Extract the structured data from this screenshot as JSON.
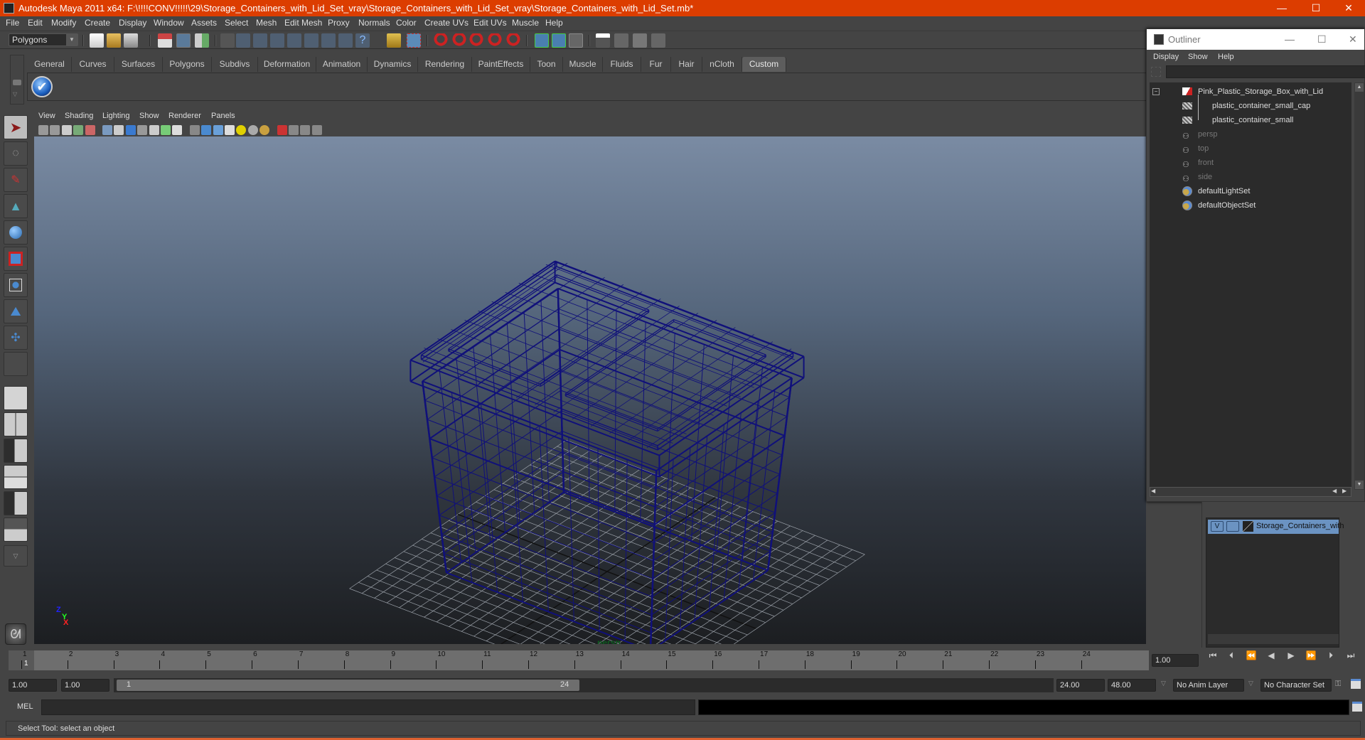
{
  "window": {
    "title": "Autodesk Maya 2011 x64: F:\\!!!!CONV!!!!!\\29\\Storage_Containers_with_Lid_Set_vray\\Storage_Containers_with_Lid_Set_vray\\Storage_Containers_with_Lid_Set.mb*",
    "minimize": "—",
    "maximize": "☐",
    "close": "✕"
  },
  "menubar": {
    "items": [
      "File",
      "Edit",
      "Modify",
      "Create",
      "Display",
      "Window",
      "Assets",
      "Select",
      "Mesh",
      "Edit Mesh",
      "Proxy",
      "Normals",
      "Color",
      "Create UVs",
      "Edit UVs",
      "Muscle",
      "Help"
    ]
  },
  "toolbar": {
    "menuset": "Polygons",
    "icons": [
      "new-scene-icon",
      "open-scene-icon",
      "save-scene-icon",
      "select-by-hierarchy-icon",
      "select-by-object-icon",
      "select-by-component-icon",
      "mask-menu-icon",
      "select-handles-icon",
      "select-joints-icon",
      "select-curves-icon",
      "select-surfaces-icon",
      "select-deformations-icon",
      "select-dynamics-icon",
      "select-rendering-icon",
      "select-misc-icon",
      "lock-selection-icon",
      "highlight-selection-icon",
      "snap-grid-icon",
      "snap-curve-icon",
      "snap-point-icon",
      "snap-view-plane-icon",
      "make-live-icon",
      "input-ops-icon",
      "output-ops-icon",
      "construction-history-icon",
      "render-view-icon",
      "render-current-icon",
      "ipr-render-icon",
      "render-settings-icon"
    ]
  },
  "shelf": {
    "tabs": [
      "General",
      "Curves",
      "Surfaces",
      "Polygons",
      "Subdivs",
      "Deformation",
      "Animation",
      "Dynamics",
      "Rendering",
      "PaintEffects",
      "Toon",
      "Muscle",
      "Fluids",
      "Fur",
      "Hair",
      "nCloth",
      "Custom"
    ],
    "active_tab": "Custom",
    "items": [
      "checkmark-shelf-icon"
    ]
  },
  "toolbox": {
    "tools": [
      "select-tool-icon",
      "lasso-tool-icon",
      "paint-select-tool-icon",
      "move-tool-icon",
      "rotate-tool-icon",
      "scale-tool-icon",
      "universal-manipulator-icon",
      "soft-mod-tool-icon",
      "show-manipulator-icon",
      "last-tool-slot"
    ],
    "layouts": [
      "single-perspective-layout-icon",
      "four-view-layout-icon",
      "outliner-persp-layout-icon",
      "persp-graph-layout-icon",
      "hypershade-persp-layout-icon",
      "persp-hypergraph-graph-layout-icon"
    ]
  },
  "viewport": {
    "menus": [
      "View",
      "Shading",
      "Lighting",
      "Show",
      "Renderer",
      "Panels"
    ],
    "camera_label": "persp",
    "axis_labels": {
      "x": "X",
      "y": "Y",
      "z": "Z"
    },
    "wire_color": "#10107a"
  },
  "timeline": {
    "ticks": [
      "1",
      "2",
      "3",
      "4",
      "5",
      "6",
      "7",
      "8",
      "9",
      "10",
      "11",
      "12",
      "13",
      "14",
      "15",
      "16",
      "17",
      "18",
      "19",
      "20",
      "21",
      "22",
      "23",
      "24"
    ],
    "current_frame_marker": "1",
    "current_time": "1.00"
  },
  "range": {
    "start_time": "1.00",
    "playback_start": "1.00",
    "range_start_label": "1",
    "range_end_label": "24",
    "playback_end": "24.00",
    "end_time": "48.00",
    "anim_layer": "No Anim Layer",
    "character_set": "No Character Set"
  },
  "command": {
    "label": "MEL",
    "input_value": ""
  },
  "help_line": "Select Tool: select an object",
  "outliner": {
    "title": "Outliner",
    "menus": [
      "Display",
      "Show",
      "Help"
    ],
    "filter_value": "",
    "items": [
      {
        "label": "Pink_Plastic_Storage_Box_with_Lid",
        "type": "group",
        "dim": false
      },
      {
        "label": "plastic_container_small_cap",
        "type": "mesh",
        "dim": false
      },
      {
        "label": "plastic_container_small",
        "type": "mesh",
        "dim": false
      },
      {
        "label": "persp",
        "type": "camera",
        "dim": true
      },
      {
        "label": "top",
        "type": "camera",
        "dim": true
      },
      {
        "label": "front",
        "type": "camera",
        "dim": true
      },
      {
        "label": "side",
        "type": "camera",
        "dim": true
      },
      {
        "label": "defaultLightSet",
        "type": "set",
        "dim": false
      },
      {
        "label": "defaultObjectSet",
        "type": "set",
        "dim": false
      }
    ]
  },
  "layer_editor": {
    "layers": [
      {
        "visible": "V",
        "name": "Storage_Containers_with"
      }
    ]
  }
}
